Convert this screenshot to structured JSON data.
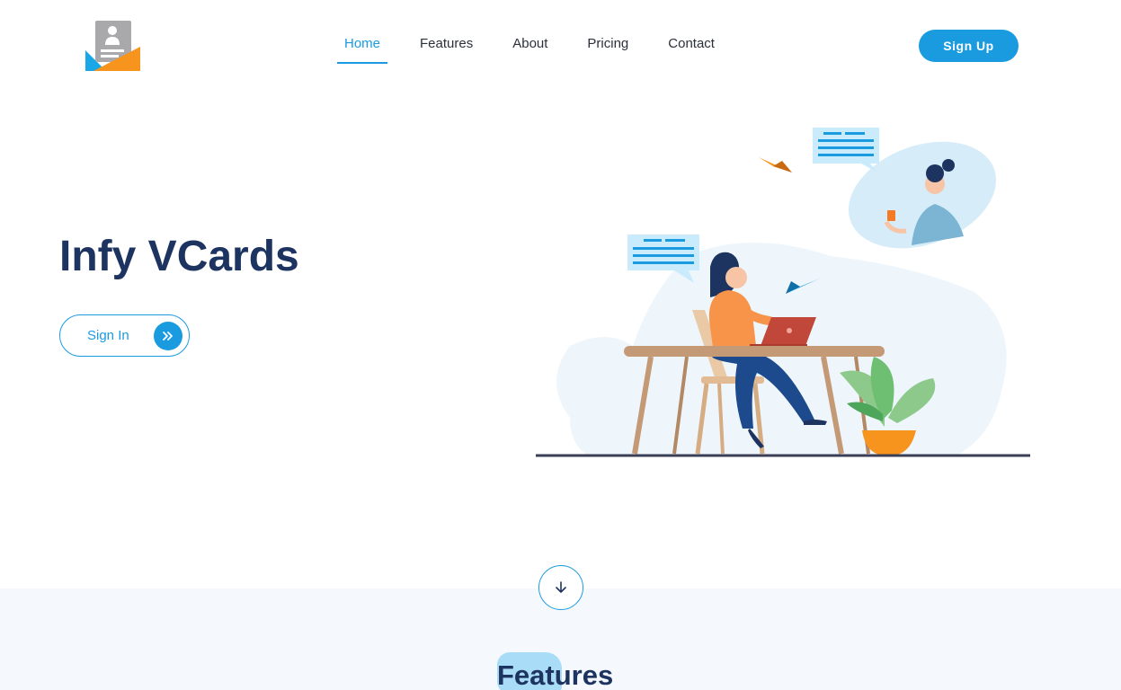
{
  "header": {
    "logo_icon": "vcard-logo-icon",
    "nav": [
      {
        "label": "Home",
        "active": true
      },
      {
        "label": "Features",
        "active": false
      },
      {
        "label": "About",
        "active": false
      },
      {
        "label": "Pricing",
        "active": false
      },
      {
        "label": "Contact",
        "active": false
      }
    ],
    "signup_label": "Sign Up"
  },
  "hero": {
    "title": "Infy VCards",
    "signin_label": "Sign In",
    "signin_icon": "double-chevron-right-icon",
    "illustration": "woman-at-laptop-video-call-illustration"
  },
  "scroll_icon": "arrow-down-icon",
  "features": {
    "heading": "Features"
  },
  "colors": {
    "accent": "#1a9be0",
    "heading": "#1d3461",
    "band": "#f5f9fd"
  }
}
